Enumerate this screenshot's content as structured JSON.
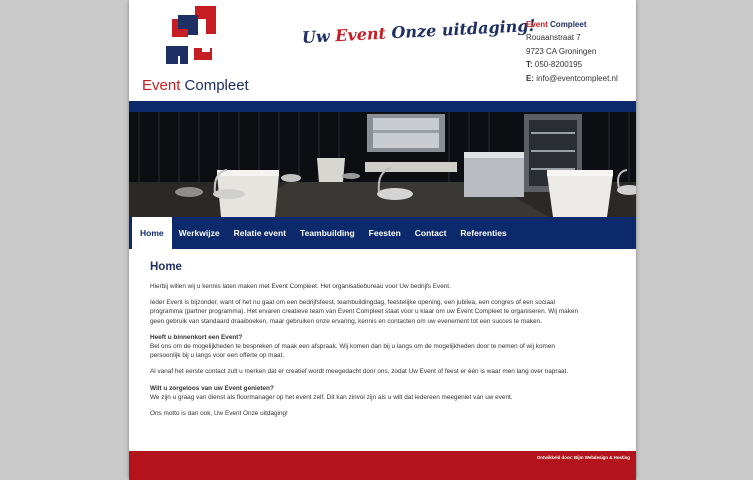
{
  "brand": {
    "name_part1": "Event",
    "name_part2": "Compleet",
    "colors": {
      "navy": "#0c2a6b",
      "red": "#c61d22",
      "footer_red": "#b3141b"
    }
  },
  "slogan": {
    "part1": "Uw",
    "part2": "Event",
    "part3": "Onze uitdaging!"
  },
  "contact": {
    "name_part1": "Event",
    "name_part2": "Compleet",
    "street": "Rouaanstraat 7",
    "city": "9723 CA Groningen",
    "phone_label": "T:",
    "phone": "050-8200195",
    "email_label": "E:",
    "email": "info@eventcompleet.nl"
  },
  "nav": {
    "items": [
      {
        "label": "Home",
        "active": true
      },
      {
        "label": "Werkwijze"
      },
      {
        "label": "Relatie event"
      },
      {
        "label": "Teambuilding"
      },
      {
        "label": "Feesten"
      },
      {
        "label": "Contact"
      },
      {
        "label": "Referenties"
      }
    ]
  },
  "main": {
    "title": "Home",
    "intro": "Hierbij willen wij u kennis laten maken met Event Compleet. Het organisatiebureau voor Uw bedrijfs Event.",
    "para2": "Ieder Event is bijzonder, want of het nu gaat om een bedrijfsfeest, teambuildingdag, feestelijke opening, een jubilea, een congres of een sociaal programma (partner programma). Het ervaren creatieve team van Event Compleet staat voor u klaar om uw Event Compleet te organiseren. Wij maken geen gebruik van standaard draaiboeken, maar gebruiken onze ervaring, kennis en contacten om uw evenement tot een succes te maken.",
    "heading1": "Heeft u binnenkort een Event?",
    "para3": "Bel ons om de mogelijkheden te bespreken of maak een afspraak. Wij komen dan bij u langs om de mogelijkheden door te nemen of wij komen persoonlijk bij u langs voor een offerte op maat.",
    "para4": "Al vanaf het eerste contact zult u merken dat er creatief wordt meegedacht door ons, zodat Uw Event of feest er één is waar men lang over napraat.",
    "heading2": "Wilt u zorgeloos van uw Event genieten?",
    "para5": "We zijn u graag van dienst als floormanager op het event zelf. Dit kan zinvol zijn als u wilt dat iedereen meegeniet van uw event.",
    "para6": "Ons motto is dan ook, Uw Event Onze uitdaging!"
  },
  "footer": {
    "credit": "Ontwikkeld door: Bijm Webdesign & Hosting"
  }
}
